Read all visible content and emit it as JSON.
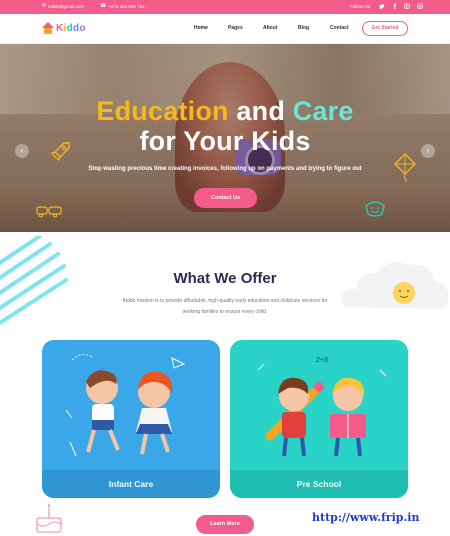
{
  "topbar": {
    "email": "kiddo@gmail.com",
    "phone": "+976 254 898 754",
    "follow_label": "Follow Us:",
    "social_icons": [
      "twitter-icon",
      "facebook-icon",
      "pinterest-icon",
      "instagram-icon"
    ]
  },
  "nav": {
    "logo_text": [
      "K",
      "i",
      "d",
      "d",
      "o"
    ],
    "links": [
      "Home",
      "Pages",
      "About",
      "Blog",
      "Contact"
    ],
    "active": "Home",
    "cta": "Get Started"
  },
  "hero": {
    "title_part1": "Education",
    "title_part2": "and",
    "title_part3": "Care",
    "title_line2": "for Your Kids",
    "subtitle": "Stop wasting precious time creating invoices, following up on payments and trying to figure out",
    "cta": "Contact Us"
  },
  "offer": {
    "title": "What We Offer",
    "description": "Kiddo mission is to provide affordable, high-quality early education and childcare services for working families to ensure every child.",
    "cards": [
      {
        "label": "Infant Care"
      },
      {
        "label": "Pre School"
      }
    ],
    "more_button": "Learn More"
  },
  "watermark": "http://www.frip.in",
  "colors": {
    "brand_pink": "#f25b8a",
    "yellow": "#f7b81c",
    "teal": "#29d3c8",
    "blue": "#3aa7e8",
    "navy": "#2c2a55"
  }
}
